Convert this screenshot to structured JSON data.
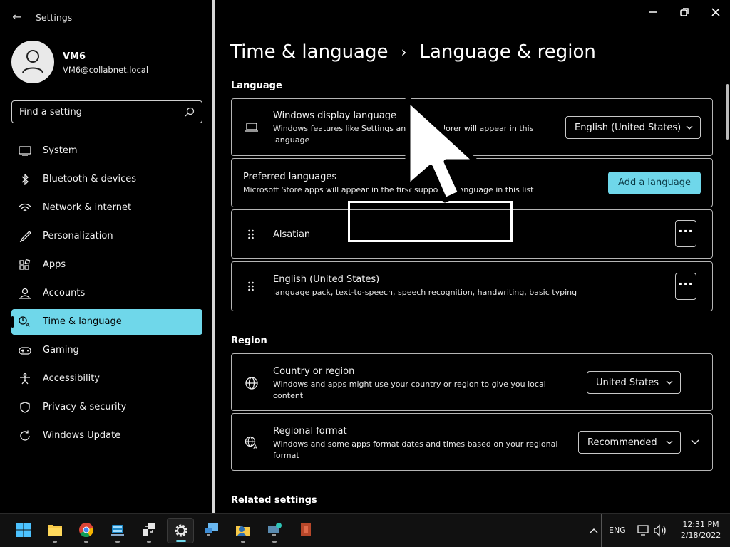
{
  "app": {
    "title": "Settings"
  },
  "user": {
    "name": "VM6",
    "email": "VM6@collabnet.local"
  },
  "search": {
    "placeholder": "Find a setting"
  },
  "nav": [
    {
      "label": "System",
      "icon": "monitor-icon"
    },
    {
      "label": "Bluetooth & devices",
      "icon": "bluetooth-icon"
    },
    {
      "label": "Network & internet",
      "icon": "wifi-icon"
    },
    {
      "label": "Personalization",
      "icon": "brush-icon"
    },
    {
      "label": "Apps",
      "icon": "apps-icon"
    },
    {
      "label": "Accounts",
      "icon": "person-icon"
    },
    {
      "label": "Time & language",
      "icon": "time-language-icon",
      "active": true
    },
    {
      "label": "Gaming",
      "icon": "gamepad-icon"
    },
    {
      "label": "Accessibility",
      "icon": "accessibility-icon"
    },
    {
      "label": "Privacy & security",
      "icon": "shield-icon"
    },
    {
      "label": "Windows Update",
      "icon": "update-icon"
    }
  ],
  "breadcrumb": {
    "parent": "Time & language",
    "separator": "›",
    "current": "Language & region"
  },
  "language": {
    "heading": "Language",
    "display": {
      "title": "Windows display language",
      "desc": "Windows features like Settings and File Explorer will appear in this language",
      "value": "English (United States)"
    },
    "preferred": {
      "title": "Preferred languages",
      "desc": "Microsoft Store apps will appear in the first supported language in this list",
      "button": "Add a language"
    },
    "items": [
      {
        "name": "Alsatian",
        "desc": ""
      },
      {
        "name": "English (United States)",
        "desc": "language pack, text-to-speech, speech recognition, handwriting, basic typing"
      }
    ],
    "more_label": "···"
  },
  "region": {
    "heading": "Region",
    "country": {
      "title": "Country or region",
      "desc": "Windows and apps might use your country or region to give you local content",
      "value": "United States"
    },
    "format": {
      "title": "Regional format",
      "desc": "Windows and some apps format dates and times based on your regional format",
      "value": "Recommended"
    }
  },
  "related": {
    "heading": "Related settings"
  },
  "taskbar": {
    "apps": [
      "start",
      "file-explorer",
      "chrome",
      "server-manager",
      "remote-desktop",
      "settings",
      "network",
      "folder-user",
      "monitor-app",
      "office"
    ],
    "active_app": "settings",
    "language": "ENG",
    "time": "12:31 PM",
    "date": "2/18/2022"
  },
  "colors": {
    "accent": "#6fd7ea",
    "background": "#000000",
    "text": "#ffffff"
  }
}
